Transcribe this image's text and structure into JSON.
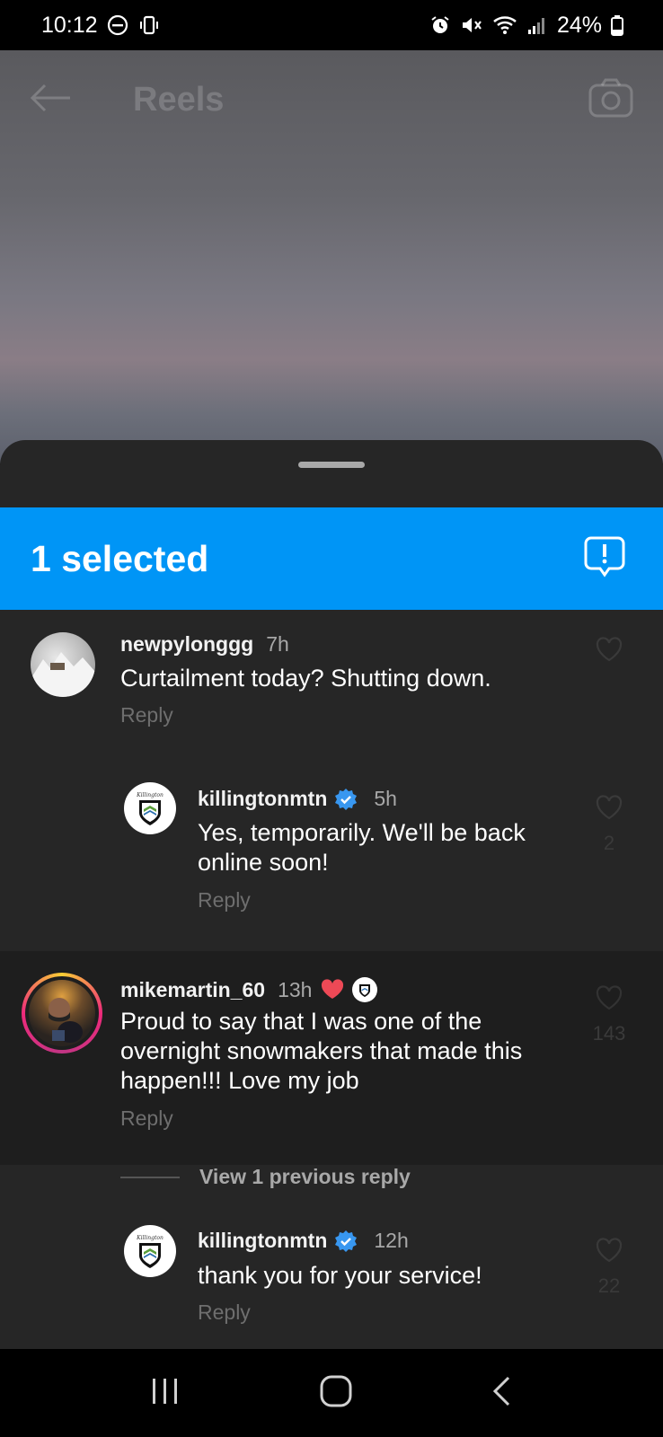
{
  "status_bar": {
    "time": "10:12",
    "battery": "24%"
  },
  "header": {
    "title": "Reels"
  },
  "selection": {
    "label": "1 selected"
  },
  "comments": [
    {
      "username": "newpylonggg",
      "time": "7h",
      "text": "Curtailment today? Shutting down.",
      "reply_label": "Reply",
      "like_count": ""
    },
    {
      "username": "killingtonmtn",
      "time": "5h",
      "text": "Yes, temporarily. We'll be back online soon!",
      "reply_label": "Reply",
      "like_count": "2"
    },
    {
      "username": "mikemartin_60",
      "time": "13h",
      "text": "Proud to say that I was one of the overnight snowmakers that made this happen!!! Love my job",
      "reply_label": "Reply",
      "like_count": "143"
    },
    {
      "username": "killingtonmtn",
      "time": "12h",
      "text": "thank you for your service!",
      "reply_label": "Reply",
      "like_count": "22"
    }
  ],
  "view_previous": "View 1 previous reply",
  "colors": {
    "accent": "#0095f6",
    "sheet": "#262626",
    "highlight": "#1e1e1e",
    "verified": "#3897f0",
    "heart": "#ed4956"
  }
}
